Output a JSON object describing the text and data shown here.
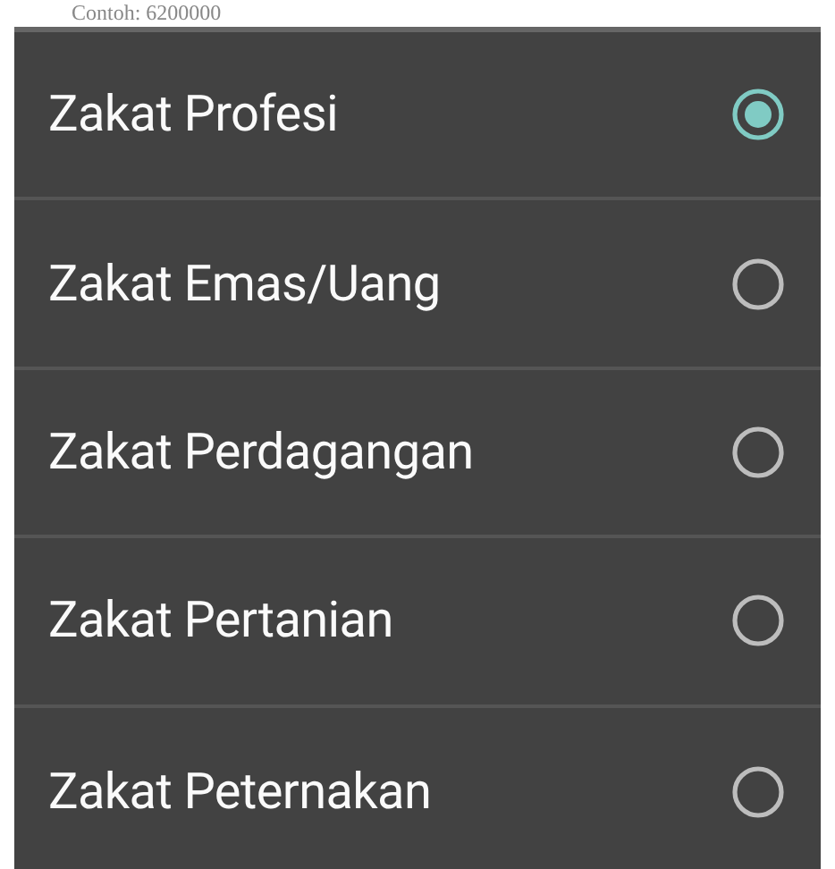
{
  "background_field": {
    "placeholder": "Contoh: 6200000"
  },
  "options": [
    {
      "label": "Zakat Profesi",
      "selected": true
    },
    {
      "label": "Zakat Emas/Uang",
      "selected": false
    },
    {
      "label": "Zakat Perdagangan",
      "selected": false
    },
    {
      "label": "Zakat Pertanian",
      "selected": false
    },
    {
      "label": "Zakat Peternakan",
      "selected": false
    }
  ]
}
